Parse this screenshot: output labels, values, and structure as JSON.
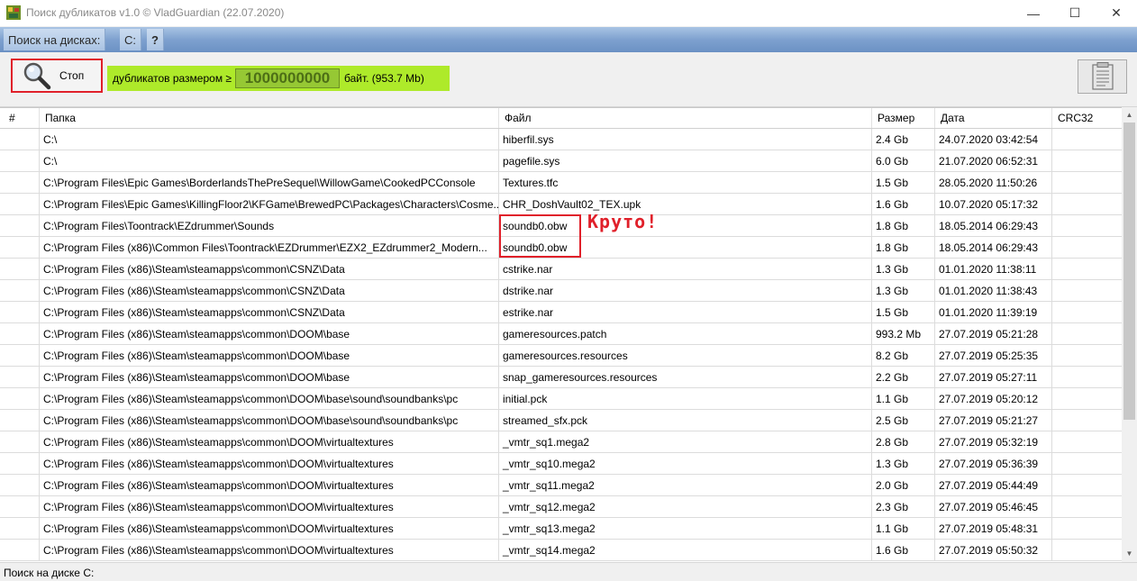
{
  "window": {
    "title": "Поиск дубликатов v1.0 © VladGuardian (22.07.2020)",
    "controls": [
      "—",
      "☐",
      "✕"
    ]
  },
  "menu": {
    "items": [
      "Поиск на дисках:",
      "C:",
      "?"
    ]
  },
  "toolbar": {
    "stop_label": "Стоп",
    "size_prefix": "дубликатов размером ≥",
    "size_value": "1000000000",
    "size_suffix": "байт. (953.7 Mb)"
  },
  "table": {
    "columns": [
      "#",
      "Папка",
      "Файл",
      "Размер",
      "Дата",
      "CRC32"
    ],
    "rows": [
      [
        "",
        "C:\\",
        "hiberfil.sys",
        "2.4 Gb",
        "24.07.2020 03:42:54",
        ""
      ],
      [
        "",
        "C:\\",
        "pagefile.sys",
        "6.0 Gb",
        "21.07.2020 06:52:31",
        ""
      ],
      [
        "",
        "C:\\Program Files\\Epic Games\\BorderlandsThePreSequel\\WillowGame\\CookedPCConsole",
        "Textures.tfc",
        "1.5 Gb",
        "28.05.2020 11:50:26",
        ""
      ],
      [
        "",
        "C:\\Program Files\\Epic Games\\KillingFloor2\\KFGame\\BrewedPC\\Packages\\Characters\\Cosme...",
        "CHR_DoshVault02_TEX.upk",
        "1.6 Gb",
        "10.07.2020 05:17:32",
        ""
      ],
      [
        "",
        "C:\\Program Files\\Toontrack\\EZdrummer\\Sounds",
        "soundb0.obw",
        "1.8 Gb",
        "18.05.2014 06:29:43",
        ""
      ],
      [
        "",
        "C:\\Program Files (x86)\\Common Files\\Toontrack\\EZDrummer\\EZX2_EZdrummer2_Modern...",
        "soundb0.obw",
        "1.8 Gb",
        "18.05.2014 06:29:43",
        ""
      ],
      [
        "",
        "C:\\Program Files (x86)\\Steam\\steamapps\\common\\CSNZ\\Data",
        "cstrike.nar",
        "1.3 Gb",
        "01.01.2020 11:38:11",
        ""
      ],
      [
        "",
        "C:\\Program Files (x86)\\Steam\\steamapps\\common\\CSNZ\\Data",
        "dstrike.nar",
        "1.3 Gb",
        "01.01.2020 11:38:43",
        ""
      ],
      [
        "",
        "C:\\Program Files (x86)\\Steam\\steamapps\\common\\CSNZ\\Data",
        "estrike.nar",
        "1.5 Gb",
        "01.01.2020 11:39:19",
        ""
      ],
      [
        "",
        "C:\\Program Files (x86)\\Steam\\steamapps\\common\\DOOM\\base",
        "gameresources.patch",
        "993.2 Mb",
        "27.07.2019 05:21:28",
        ""
      ],
      [
        "",
        "C:\\Program Files (x86)\\Steam\\steamapps\\common\\DOOM\\base",
        "gameresources.resources",
        "8.2 Gb",
        "27.07.2019 05:25:35",
        ""
      ],
      [
        "",
        "C:\\Program Files (x86)\\Steam\\steamapps\\common\\DOOM\\base",
        "snap_gameresources.resources",
        "2.2 Gb",
        "27.07.2019 05:27:11",
        ""
      ],
      [
        "",
        "C:\\Program Files (x86)\\Steam\\steamapps\\common\\DOOM\\base\\sound\\soundbanks\\pc",
        "initial.pck",
        "1.1 Gb",
        "27.07.2019 05:20:12",
        ""
      ],
      [
        "",
        "C:\\Program Files (x86)\\Steam\\steamapps\\common\\DOOM\\base\\sound\\soundbanks\\pc",
        "streamed_sfx.pck",
        "2.5 Gb",
        "27.07.2019 05:21:27",
        ""
      ],
      [
        "",
        "C:\\Program Files (x86)\\Steam\\steamapps\\common\\DOOM\\virtualtextures",
        "_vmtr_sq1.mega2",
        "2.8 Gb",
        "27.07.2019 05:32:19",
        ""
      ],
      [
        "",
        "C:\\Program Files (x86)\\Steam\\steamapps\\common\\DOOM\\virtualtextures",
        "_vmtr_sq10.mega2",
        "1.3 Gb",
        "27.07.2019 05:36:39",
        ""
      ],
      [
        "",
        "C:\\Program Files (x86)\\Steam\\steamapps\\common\\DOOM\\virtualtextures",
        "_vmtr_sq11.mega2",
        "2.0 Gb",
        "27.07.2019 05:44:49",
        ""
      ],
      [
        "",
        "C:\\Program Files (x86)\\Steam\\steamapps\\common\\DOOM\\virtualtextures",
        "_vmtr_sq12.mega2",
        "2.3 Gb",
        "27.07.2019 05:46:45",
        ""
      ],
      [
        "",
        "C:\\Program Files (x86)\\Steam\\steamapps\\common\\DOOM\\virtualtextures",
        "_vmtr_sq13.mega2",
        "1.1 Gb",
        "27.07.2019 05:48:31",
        ""
      ],
      [
        "",
        "C:\\Program Files (x86)\\Steam\\steamapps\\common\\DOOM\\virtualtextures",
        "_vmtr_sq14.mega2",
        "1.6 Gb",
        "27.07.2019 05:50:32",
        ""
      ]
    ]
  },
  "annotation": {
    "text": "Круто!",
    "color": "#e0202a"
  },
  "status": {
    "text": "Поиск на диске C:"
  },
  "icons": {
    "app": "app-icon",
    "stop": "magnifier-icon",
    "notes": "notepad-icon"
  }
}
